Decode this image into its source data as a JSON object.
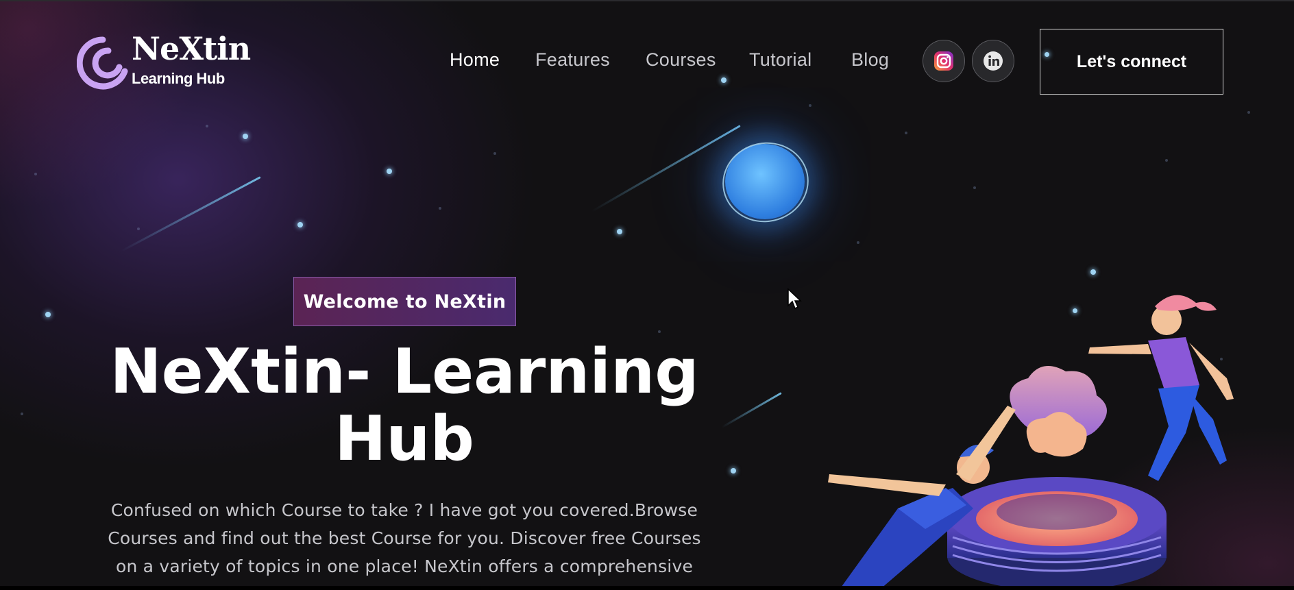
{
  "brand": {
    "name": "NeXtin",
    "subtitle": "Learning Hub",
    "accent_color": "#c9a3f2"
  },
  "nav": {
    "items": [
      {
        "label": "Home",
        "active": true
      },
      {
        "label": "Features",
        "active": false
      },
      {
        "label": "Courses",
        "active": false
      },
      {
        "label": "Tutorial",
        "active": false
      },
      {
        "label": "Blog",
        "active": false
      }
    ],
    "social": [
      {
        "icon": "instagram-icon",
        "color": "#e1306c"
      },
      {
        "icon": "linkedin-icon",
        "color": "#ffffff"
      }
    ],
    "cta_label": "Let's connect"
  },
  "hero": {
    "badge": "Welcome to NeXtin",
    "title_line1": "NeXtin- Learning",
    "title_line2": "Hub",
    "text_line1": "Confused on which Course to take ? I have got you covered.Browse",
    "text_line2": "Courses and find out the best Course for you. Discover free Courses",
    "text_line3": "on a variety of topics in one place! NeXtin offers a comprehensive"
  },
  "decor": {
    "planet_color": "#4aa3f5",
    "star_color": "#9fd3f2",
    "background_color": "#121113"
  }
}
